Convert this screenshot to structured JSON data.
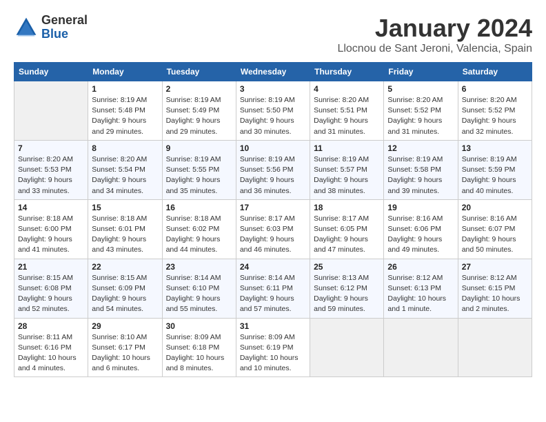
{
  "header": {
    "logo_general": "General",
    "logo_blue": "Blue",
    "title": "January 2024",
    "subtitle": "Llocnou de Sant Jeroni, Valencia, Spain"
  },
  "columns": [
    "Sunday",
    "Monday",
    "Tuesday",
    "Wednesday",
    "Thursday",
    "Friday",
    "Saturday"
  ],
  "weeks": [
    [
      {
        "day": "",
        "sunrise": "",
        "sunset": "",
        "daylight": ""
      },
      {
        "day": "1",
        "sunrise": "Sunrise: 8:19 AM",
        "sunset": "Sunset: 5:48 PM",
        "daylight": "Daylight: 9 hours and 29 minutes."
      },
      {
        "day": "2",
        "sunrise": "Sunrise: 8:19 AM",
        "sunset": "Sunset: 5:49 PM",
        "daylight": "Daylight: 9 hours and 29 minutes."
      },
      {
        "day": "3",
        "sunrise": "Sunrise: 8:19 AM",
        "sunset": "Sunset: 5:50 PM",
        "daylight": "Daylight: 9 hours and 30 minutes."
      },
      {
        "day": "4",
        "sunrise": "Sunrise: 8:20 AM",
        "sunset": "Sunset: 5:51 PM",
        "daylight": "Daylight: 9 hours and 31 minutes."
      },
      {
        "day": "5",
        "sunrise": "Sunrise: 8:20 AM",
        "sunset": "Sunset: 5:52 PM",
        "daylight": "Daylight: 9 hours and 31 minutes."
      },
      {
        "day": "6",
        "sunrise": "Sunrise: 8:20 AM",
        "sunset": "Sunset: 5:52 PM",
        "daylight": "Daylight: 9 hours and 32 minutes."
      }
    ],
    [
      {
        "day": "7",
        "sunrise": "Sunrise: 8:20 AM",
        "sunset": "Sunset: 5:53 PM",
        "daylight": "Daylight: 9 hours and 33 minutes."
      },
      {
        "day": "8",
        "sunrise": "Sunrise: 8:20 AM",
        "sunset": "Sunset: 5:54 PM",
        "daylight": "Daylight: 9 hours and 34 minutes."
      },
      {
        "day": "9",
        "sunrise": "Sunrise: 8:19 AM",
        "sunset": "Sunset: 5:55 PM",
        "daylight": "Daylight: 9 hours and 35 minutes."
      },
      {
        "day": "10",
        "sunrise": "Sunrise: 8:19 AM",
        "sunset": "Sunset: 5:56 PM",
        "daylight": "Daylight: 9 hours and 36 minutes."
      },
      {
        "day": "11",
        "sunrise": "Sunrise: 8:19 AM",
        "sunset": "Sunset: 5:57 PM",
        "daylight": "Daylight: 9 hours and 38 minutes."
      },
      {
        "day": "12",
        "sunrise": "Sunrise: 8:19 AM",
        "sunset": "Sunset: 5:58 PM",
        "daylight": "Daylight: 9 hours and 39 minutes."
      },
      {
        "day": "13",
        "sunrise": "Sunrise: 8:19 AM",
        "sunset": "Sunset: 5:59 PM",
        "daylight": "Daylight: 9 hours and 40 minutes."
      }
    ],
    [
      {
        "day": "14",
        "sunrise": "Sunrise: 8:18 AM",
        "sunset": "Sunset: 6:00 PM",
        "daylight": "Daylight: 9 hours and 41 minutes."
      },
      {
        "day": "15",
        "sunrise": "Sunrise: 8:18 AM",
        "sunset": "Sunset: 6:01 PM",
        "daylight": "Daylight: 9 hours and 43 minutes."
      },
      {
        "day": "16",
        "sunrise": "Sunrise: 8:18 AM",
        "sunset": "Sunset: 6:02 PM",
        "daylight": "Daylight: 9 hours and 44 minutes."
      },
      {
        "day": "17",
        "sunrise": "Sunrise: 8:17 AM",
        "sunset": "Sunset: 6:03 PM",
        "daylight": "Daylight: 9 hours and 46 minutes."
      },
      {
        "day": "18",
        "sunrise": "Sunrise: 8:17 AM",
        "sunset": "Sunset: 6:05 PM",
        "daylight": "Daylight: 9 hours and 47 minutes."
      },
      {
        "day": "19",
        "sunrise": "Sunrise: 8:16 AM",
        "sunset": "Sunset: 6:06 PM",
        "daylight": "Daylight: 9 hours and 49 minutes."
      },
      {
        "day": "20",
        "sunrise": "Sunrise: 8:16 AM",
        "sunset": "Sunset: 6:07 PM",
        "daylight": "Daylight: 9 hours and 50 minutes."
      }
    ],
    [
      {
        "day": "21",
        "sunrise": "Sunrise: 8:15 AM",
        "sunset": "Sunset: 6:08 PM",
        "daylight": "Daylight: 9 hours and 52 minutes."
      },
      {
        "day": "22",
        "sunrise": "Sunrise: 8:15 AM",
        "sunset": "Sunset: 6:09 PM",
        "daylight": "Daylight: 9 hours and 54 minutes."
      },
      {
        "day": "23",
        "sunrise": "Sunrise: 8:14 AM",
        "sunset": "Sunset: 6:10 PM",
        "daylight": "Daylight: 9 hours and 55 minutes."
      },
      {
        "day": "24",
        "sunrise": "Sunrise: 8:14 AM",
        "sunset": "Sunset: 6:11 PM",
        "daylight": "Daylight: 9 hours and 57 minutes."
      },
      {
        "day": "25",
        "sunrise": "Sunrise: 8:13 AM",
        "sunset": "Sunset: 6:12 PM",
        "daylight": "Daylight: 9 hours and 59 minutes."
      },
      {
        "day": "26",
        "sunrise": "Sunrise: 8:12 AM",
        "sunset": "Sunset: 6:13 PM",
        "daylight": "Daylight: 10 hours and 1 minute."
      },
      {
        "day": "27",
        "sunrise": "Sunrise: 8:12 AM",
        "sunset": "Sunset: 6:15 PM",
        "daylight": "Daylight: 10 hours and 2 minutes."
      }
    ],
    [
      {
        "day": "28",
        "sunrise": "Sunrise: 8:11 AM",
        "sunset": "Sunset: 6:16 PM",
        "daylight": "Daylight: 10 hours and 4 minutes."
      },
      {
        "day": "29",
        "sunrise": "Sunrise: 8:10 AM",
        "sunset": "Sunset: 6:17 PM",
        "daylight": "Daylight: 10 hours and 6 minutes."
      },
      {
        "day": "30",
        "sunrise": "Sunrise: 8:09 AM",
        "sunset": "Sunset: 6:18 PM",
        "daylight": "Daylight: 10 hours and 8 minutes."
      },
      {
        "day": "31",
        "sunrise": "Sunrise: 8:09 AM",
        "sunset": "Sunset: 6:19 PM",
        "daylight": "Daylight: 10 hours and 10 minutes."
      },
      {
        "day": "",
        "sunrise": "",
        "sunset": "",
        "daylight": ""
      },
      {
        "day": "",
        "sunrise": "",
        "sunset": "",
        "daylight": ""
      },
      {
        "day": "",
        "sunrise": "",
        "sunset": "",
        "daylight": ""
      }
    ]
  ]
}
